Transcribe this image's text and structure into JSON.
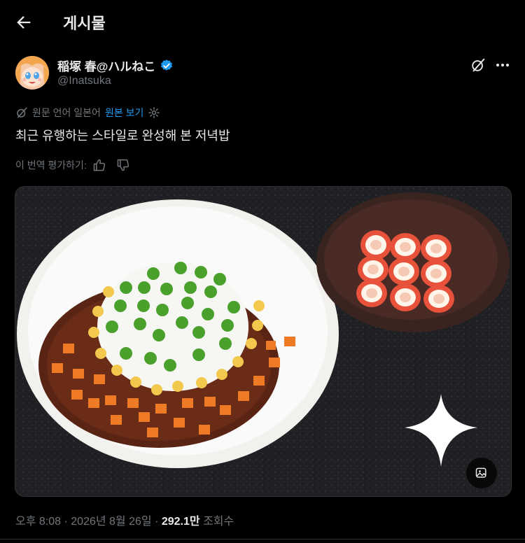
{
  "header": {
    "title": "게시물",
    "back_icon": "arrow-left-icon"
  },
  "author": {
    "display_name": "稲塚 春@ハルねこ",
    "handle": "@Inatsuka",
    "verified": true,
    "verified_color": "#1d9bf0"
  },
  "translation": {
    "info": "원문 언어 일본어",
    "show_original": "원본 보기",
    "settings_icon": "gear-icon"
  },
  "post": {
    "text": "최근 유행하는 스타일로 완성해 본 저녁밥"
  },
  "rating": {
    "label": "이 번역 평가하기:",
    "like_icon": "thumbs-up-icon",
    "dislike_icon": "thumbs-down-icon"
  },
  "media": {
    "edit_icon": "image-edit-icon"
  },
  "meta": {
    "time": "오후 8:08",
    "date": "2026년 8월 26일",
    "views": "292.1만",
    "views_label": "조회수"
  },
  "colors": {
    "background": "#000000",
    "text": "#e7e9ea",
    "muted": "#71767b",
    "accent": "#1d9bf0"
  }
}
